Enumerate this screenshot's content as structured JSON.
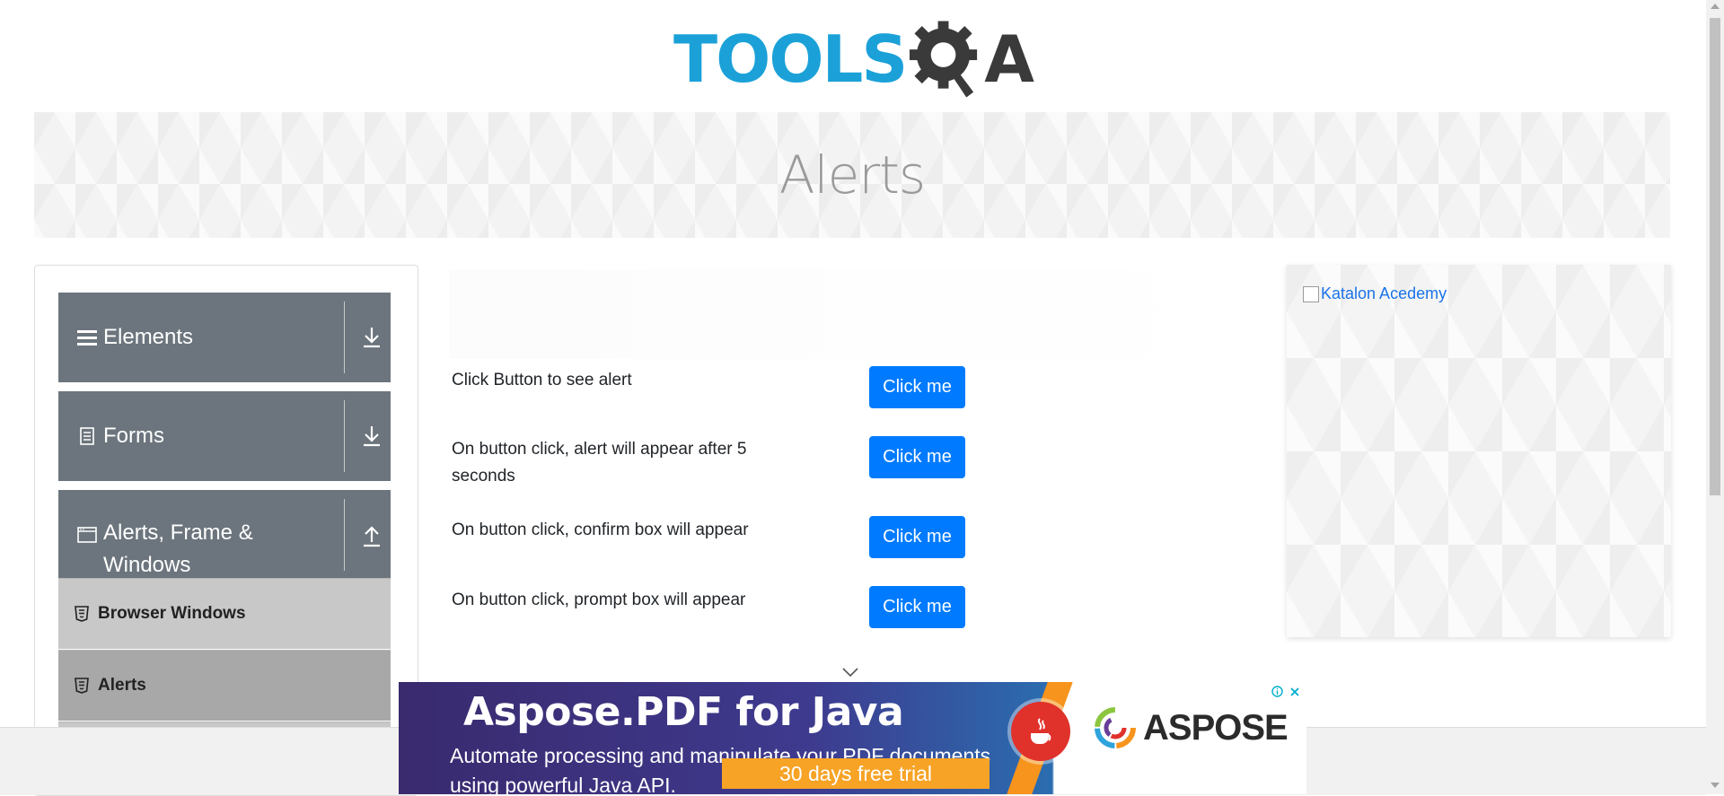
{
  "header": {
    "logo_tools": "TOOLS",
    "logo_qa": "A"
  },
  "banner": {
    "title": "Alerts"
  },
  "sidebar": {
    "groups": [
      {
        "label": "Elements",
        "icon": "hamburger-icon",
        "arrow": "download-arrow-icon"
      },
      {
        "label": "Forms",
        "icon": "document-icon",
        "arrow": "download-arrow-icon"
      },
      {
        "label": "Alerts, Frame & Windows",
        "icon": "window-icon",
        "arrow": "upload-arrow-icon"
      }
    ],
    "items": [
      {
        "label": "Browser Windows",
        "icon": "html5-icon"
      },
      {
        "label": "Alerts",
        "icon": "html5-icon"
      }
    ]
  },
  "main": {
    "rows": [
      {
        "label": "Click Button to see alert",
        "button": "Click me"
      },
      {
        "label": "On button click, alert will appear after 5 seconds",
        "button": "Click me"
      },
      {
        "label": "On button click, confirm box will appear",
        "button": "Click me"
      },
      {
        "label": "On button click, prompt box will appear",
        "button": "Click me"
      }
    ]
  },
  "right_ad": {
    "alt_text": "Katalon Acedemy"
  },
  "bottom_ad": {
    "title": "Aspose.PDF for Java",
    "subtitle": "Automate processing and manipulate your PDF documents using powerful Java API.",
    "cta": "30 days free trial",
    "brand": "ASPOSE"
  },
  "colors": {
    "primary_button": "#007bff",
    "sidebar_group": "#6c757d",
    "sidebar_item": "#c8c8c8",
    "sidebar_item_active": "#a8a8a8",
    "logo_blue": "#1ba1d8"
  }
}
